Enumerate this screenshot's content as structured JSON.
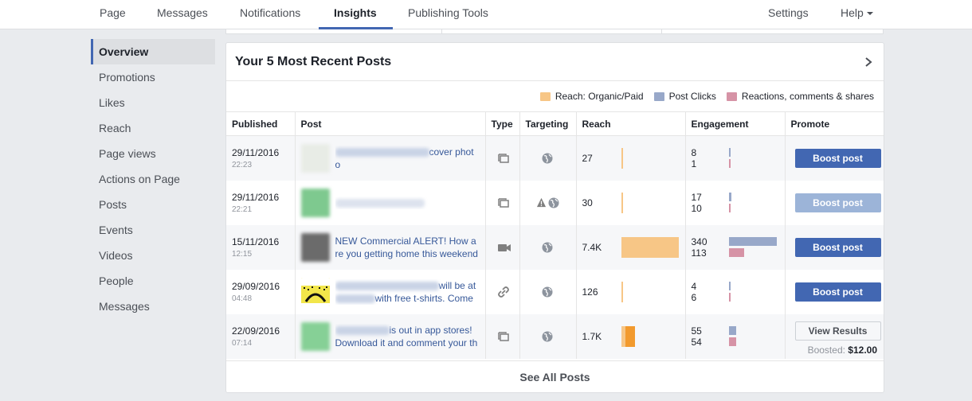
{
  "nav": {
    "tabs": [
      "Page",
      "Messages",
      "Notifications",
      "Insights",
      "Publishing Tools"
    ],
    "active_tab": "Insights",
    "settings": "Settings",
    "help": "Help"
  },
  "sidebar": {
    "items": [
      "Overview",
      "Promotions",
      "Likes",
      "Reach",
      "Page views",
      "Actions on Page",
      "Posts",
      "Events",
      "Videos",
      "People",
      "Messages"
    ],
    "active": "Overview"
  },
  "card": {
    "title": "Your 5 Most Recent Posts",
    "legend": [
      {
        "label": "Reach: Organic/Paid",
        "color": "#f7c686"
      },
      {
        "label": "Post Clicks",
        "color": "#98a8c9"
      },
      {
        "label": "Reactions, comments & shares",
        "color": "#d693a6"
      }
    ],
    "columns": [
      "Published",
      "Post",
      "Type",
      "Targeting",
      "Reach",
      "Engagement",
      "Promote"
    ],
    "see_all": "See All Posts"
  },
  "posts": [
    {
      "date": "29/11/2016",
      "time": "22:23",
      "line1": "cover phot",
      "line2": "o",
      "type": "photo-icon",
      "targeting": "globe-icon",
      "reach": "27",
      "reach_level": 0.01,
      "clicks": "8",
      "reactions": "1",
      "promote": "Boost post",
      "promote_state": "enabled",
      "thumb_color": "#e8ece6"
    },
    {
      "date": "29/11/2016",
      "time": "22:21",
      "line1": "",
      "line2": "",
      "type": "photo-icon",
      "targeting": "warning-globe-icon",
      "reach": "30",
      "reach_level": 0.01,
      "clicks": "17",
      "reactions": "10",
      "promote": "Boost post",
      "promote_state": "disabled",
      "thumb_color": "#7ec98f"
    },
    {
      "date": "15/11/2016",
      "time": "12:15",
      "line1": "NEW Commercial ALERT! How a",
      "line2": "re you getting home this weekend",
      "type": "video-icon",
      "targeting": "globe-icon",
      "reach": "7.4K",
      "reach_level": 1.0,
      "clicks": "340",
      "reactions": "113",
      "promote": "Boost post",
      "promote_state": "enabled",
      "thumb_color": "#6b6b6b"
    },
    {
      "date": "29/09/2016",
      "time": "04:48",
      "line1": "will be at",
      "line2": "with free t-shirts. Come",
      "type": "link-icon",
      "targeting": "globe-icon",
      "reach": "126",
      "reach_level": 0.02,
      "clicks": "4",
      "reactions": "6",
      "promote": "Boost post",
      "promote_state": "enabled",
      "thumb_color": "#f2e64a"
    },
    {
      "date": "22/09/2016",
      "time": "07:14",
      "line1": "is out in app stores!",
      "line2": "Download it and comment your th",
      "type": "photo-icon",
      "targeting": "globe-icon",
      "reach": "1.7K",
      "reach_level": 0.23,
      "clicks": "55",
      "reactions": "54",
      "promote": "View Results",
      "promote_state": "results",
      "boosted_label": "Boosted:",
      "boosted_amount": "$12.00",
      "thumb_color": "#86d096"
    }
  ]
}
